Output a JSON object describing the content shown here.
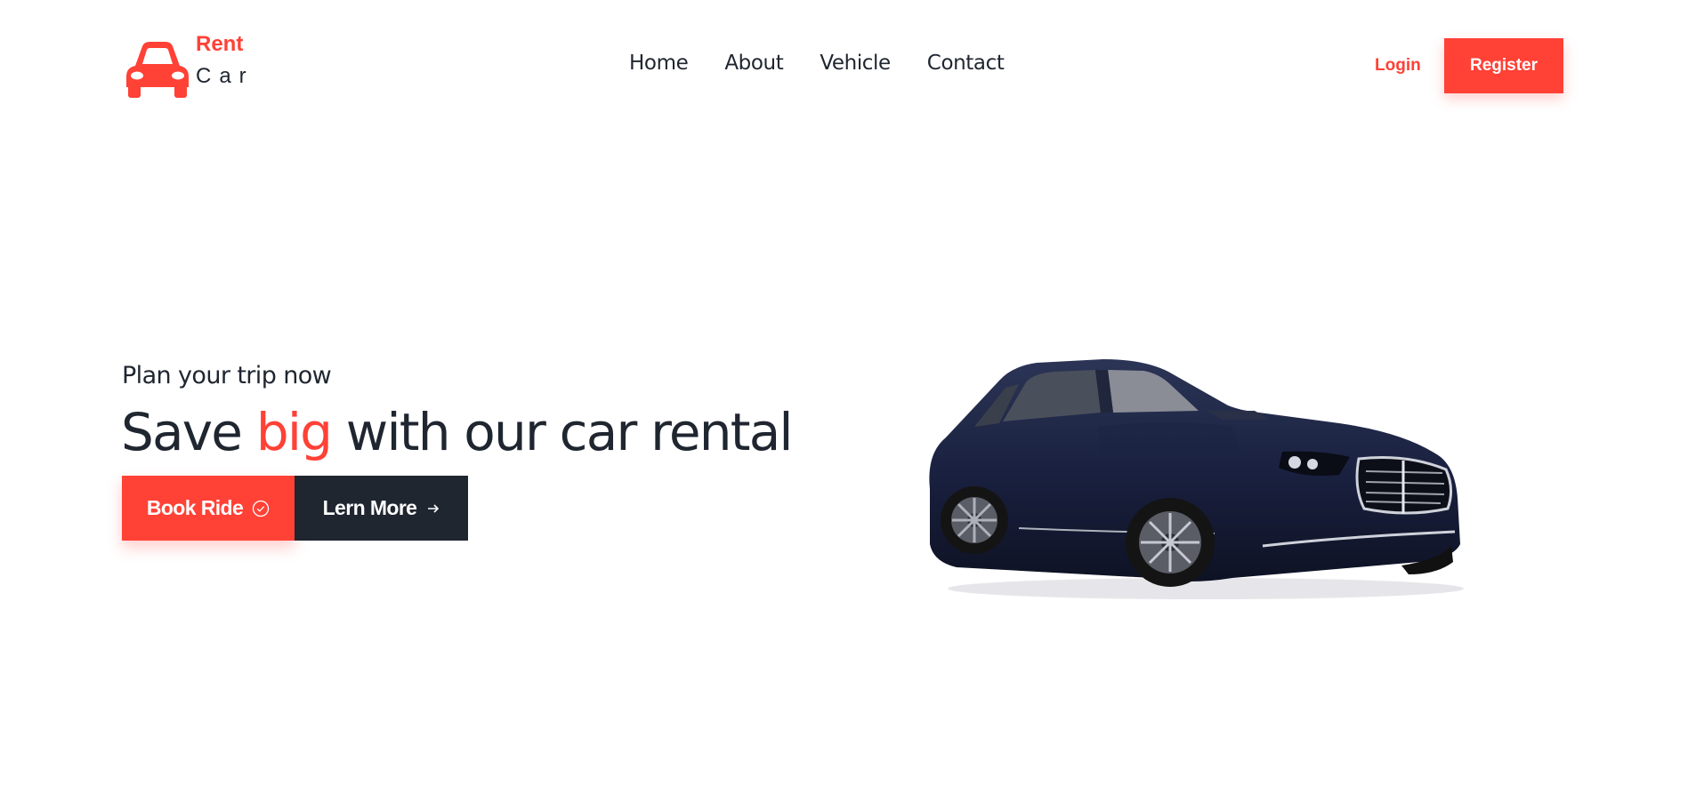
{
  "logo": {
    "line1": "Rent",
    "line2": "Car"
  },
  "nav": {
    "items": [
      "Home",
      "About",
      "Vehicle",
      "Contact"
    ]
  },
  "auth": {
    "login_label": "Login",
    "register_label": "Register"
  },
  "hero": {
    "subtitle": "Plan your trip now",
    "title_before": "Save ",
    "title_accent": "big",
    "title_after": " with our car rental",
    "book_label": "Book Ride",
    "learn_label": "Lern More"
  },
  "colors": {
    "accent": "#ff4136",
    "dark": "#1f2630",
    "background": "#ffffff"
  },
  "icons": {
    "logo": "car-icon",
    "book": "check-circle-icon",
    "learn": "arrow-right-icon"
  }
}
